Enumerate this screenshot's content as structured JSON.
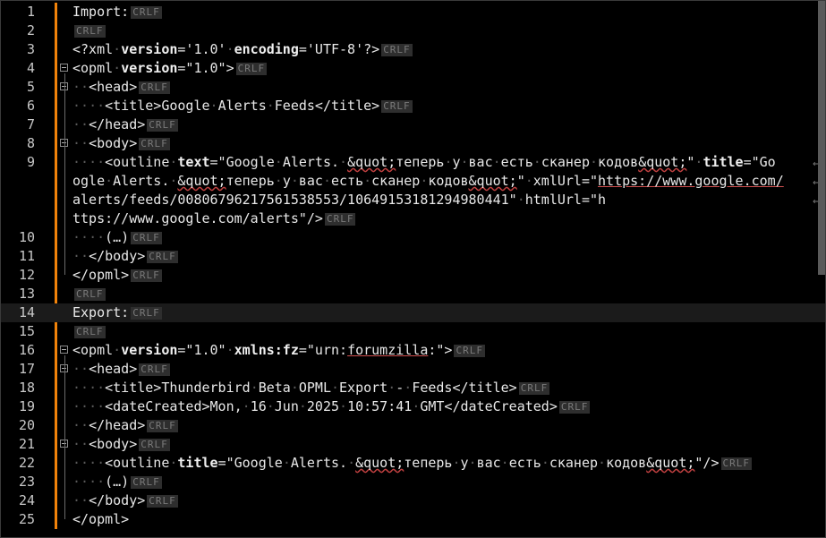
{
  "editor": {
    "eol_label": "CRLF",
    "wrap_icon": "wrap-arrow-icon",
    "lines": [
      {
        "n": "1",
        "text": "Import:"
      },
      {
        "n": "2",
        "text": ""
      },
      {
        "n": "3",
        "text": "<?xml version='1.0' encoding='UTF-8'?>"
      },
      {
        "n": "4",
        "text": "<opml version=\"1.0\">"
      },
      {
        "n": "5",
        "text": "  <head>"
      },
      {
        "n": "6",
        "text": "    <title>Google Alerts Feeds</title>"
      },
      {
        "n": "7",
        "text": "  </head>"
      },
      {
        "n": "8",
        "text": "  <body>"
      },
      {
        "n": "9",
        "text": "    <outline text=\"Google Alerts. &quot;теперь у вас есть сканер кодов&quot;\" title=\"Google Alerts. &quot;теперь у вас есть сканер кодов&quot;\" xmlUrl=\"https://www.google.com/alerts/feeds/00806796217561538553/10649153181294980441\" htmlUrl=\"https://www.google.com/alerts\"/>"
      },
      {
        "n": "10",
        "text": "    (…)"
      },
      {
        "n": "11",
        "text": "  </body>"
      },
      {
        "n": "12",
        "text": "</opml>"
      },
      {
        "n": "13",
        "text": ""
      },
      {
        "n": "14",
        "text": "Export:"
      },
      {
        "n": "15",
        "text": ""
      },
      {
        "n": "16",
        "text": "<opml version=\"1.0\" xmlns:fz=\"urn:forumzilla:\">"
      },
      {
        "n": "17",
        "text": "  <head>"
      },
      {
        "n": "18",
        "text": "    <title>Thunderbird Beta OPML Export - Feeds</title>"
      },
      {
        "n": "19",
        "text": "    <dateCreated>Mon, 16 Jun 2025 10:57:41 GMT</dateCreated>"
      },
      {
        "n": "20",
        "text": "  </head>"
      },
      {
        "n": "21",
        "text": "  <body>"
      },
      {
        "n": "22",
        "text": "    <outline title=\"Google Alerts. &quot;теперь у вас есть сканер кодов&quot;\"/>"
      },
      {
        "n": "23",
        "text": "    (…)"
      },
      {
        "n": "24",
        "text": "  </body>"
      },
      {
        "n": "25",
        "text": "</opml>"
      }
    ]
  }
}
